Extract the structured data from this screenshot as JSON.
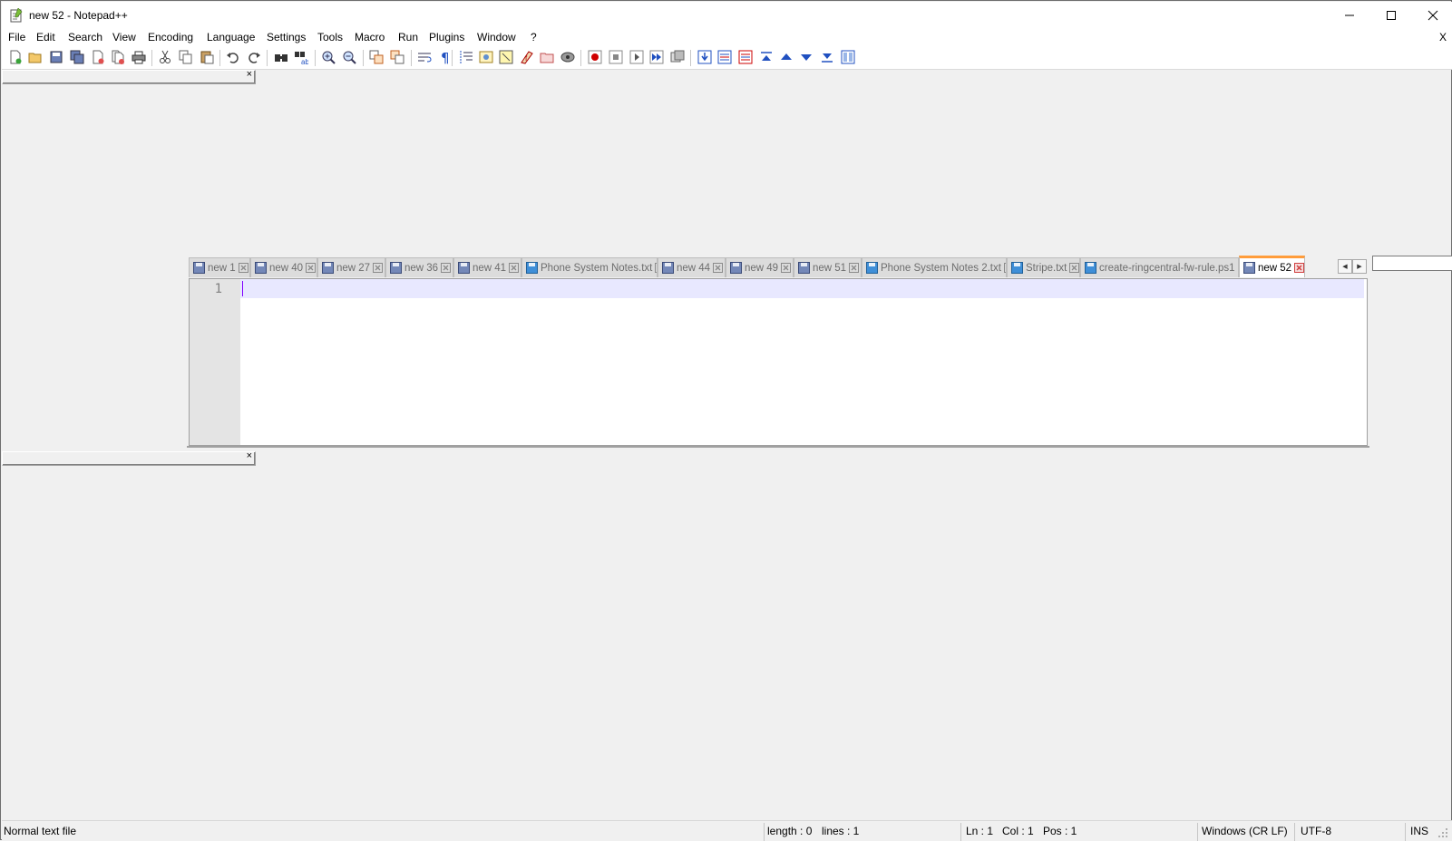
{
  "window": {
    "title": "new 52 - Notepad++"
  },
  "menu": {
    "items": [
      "File",
      "Edit",
      "Search",
      "View",
      "Encoding",
      "Language",
      "Settings",
      "Tools",
      "Macro",
      "Run",
      "Plugins",
      "Window",
      "?"
    ],
    "close_label": "X"
  },
  "toolbar": {
    "buttons": [
      "new-file-icon",
      "open-file-icon",
      "save-icon",
      "save-all-icon",
      "close-icon",
      "close-all-icon",
      "print-icon",
      "cut-icon",
      "copy-icon",
      "paste-icon",
      "undo-icon",
      "redo-icon",
      "find-icon",
      "replace-icon",
      "zoom-in-icon",
      "zoom-out-icon",
      "sync-vertical-icon",
      "sync-horizontal-icon",
      "word-wrap-icon",
      "show-all-chars-icon",
      "indent-guide-icon",
      "user-define-lang-icon",
      "doc-map-icon",
      "function-list-icon",
      "folder-as-workspace-icon",
      "monitoring-icon",
      "record-macro-icon",
      "stop-macro-icon",
      "play-macro-icon",
      "run-macro-multiple-icon",
      "save-macro-icon",
      "compare-icon",
      "compare-two-icon",
      "compare-three-icon",
      "first-diff-icon",
      "prev-diff-icon",
      "next-diff-icon",
      "last-diff-icon",
      "nav-bar-icon"
    ]
  },
  "panels": {
    "close_label": "×"
  },
  "tabs": [
    {
      "label": "new 1",
      "saved": false
    },
    {
      "label": "new 40",
      "saved": false
    },
    {
      "label": "new 27",
      "saved": false
    },
    {
      "label": "new 36",
      "saved": false
    },
    {
      "label": "new 41",
      "saved": false
    },
    {
      "label": "Phone System Notes.txt",
      "saved": true
    },
    {
      "label": "new 44",
      "saved": false
    },
    {
      "label": "new 49",
      "saved": false
    },
    {
      "label": "new 51",
      "saved": false
    },
    {
      "label": "Phone System Notes 2.txt",
      "saved": true
    },
    {
      "label": "Stripe.txt",
      "saved": true
    },
    {
      "label": "create-ringcentral-fw-rule.ps1",
      "saved": true
    },
    {
      "label": "new 52",
      "saved": false,
      "active": true
    }
  ],
  "editor": {
    "line_number": "1",
    "content": ""
  },
  "status": {
    "file_type": "Normal text file",
    "length": "length : 0",
    "lines": "lines : 1",
    "ln": "Ln : 1",
    "col": "Col : 1",
    "pos": "Pos : 1",
    "eol": "Windows (CR LF)",
    "encoding": "UTF-8",
    "mode": "INS"
  },
  "colors": {
    "active_tab_accent": "#ff9c3a",
    "current_line": "#e8e8ff",
    "caret": "#8000ff"
  }
}
